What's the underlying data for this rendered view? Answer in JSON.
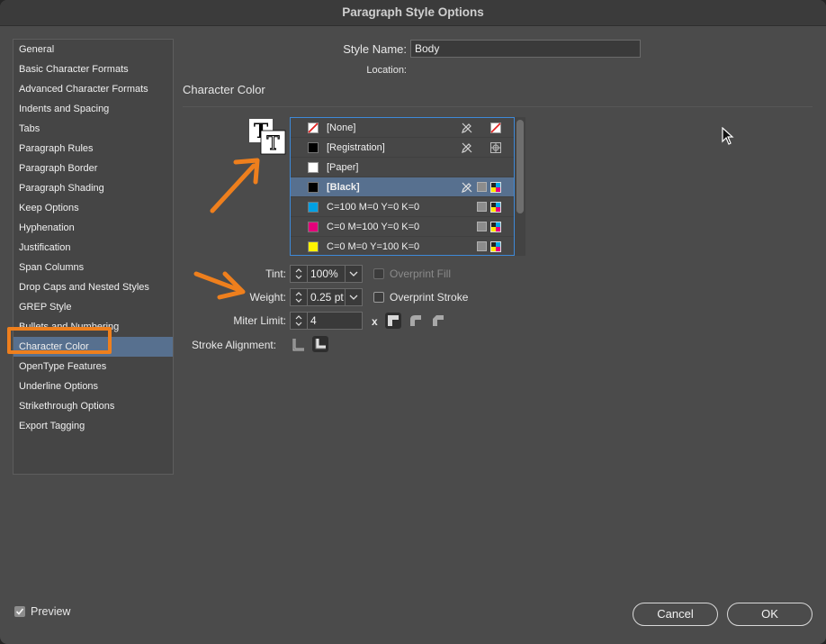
{
  "window": {
    "title": "Paragraph Style Options"
  },
  "sidebar": {
    "items": [
      {
        "label": "General"
      },
      {
        "label": "Basic Character Formats"
      },
      {
        "label": "Advanced Character Formats"
      },
      {
        "label": "Indents and Spacing"
      },
      {
        "label": "Tabs"
      },
      {
        "label": "Paragraph Rules"
      },
      {
        "label": "Paragraph Border"
      },
      {
        "label": "Paragraph Shading"
      },
      {
        "label": "Keep Options"
      },
      {
        "label": "Hyphenation"
      },
      {
        "label": "Justification"
      },
      {
        "label": "Span Columns"
      },
      {
        "label": "Drop Caps and Nested Styles"
      },
      {
        "label": "GREP Style"
      },
      {
        "label": "Bullets and Numbering"
      },
      {
        "label": "Character Color",
        "selected": true
      },
      {
        "label": "OpenType Features"
      },
      {
        "label": "Underline Options"
      },
      {
        "label": "Strikethrough Options"
      },
      {
        "label": "Export Tagging"
      }
    ]
  },
  "header": {
    "style_name_label": "Style Name:",
    "style_name_value": "Body",
    "location_label": "Location:"
  },
  "section": {
    "title": "Character Color"
  },
  "swatches": [
    {
      "name": "[None]",
      "color": "none",
      "icons": [
        "pencil-icon",
        "none-swatch-icon"
      ]
    },
    {
      "name": "[Registration]",
      "color": "#000000",
      "icons": [
        "pencil-icon",
        "registration-icon"
      ]
    },
    {
      "name": "[Paper]",
      "color": "#ffffff",
      "icons": []
    },
    {
      "name": "[Black]",
      "color": "#000000",
      "icons": [
        "pencil-icon",
        "gray-box-icon",
        "cmyk-icon"
      ],
      "selected": true
    },
    {
      "name": "C=100 M=0 Y=0 K=0",
      "color": "#00a0e4",
      "icons": [
        "gray-box-icon",
        "cmyk-icon"
      ]
    },
    {
      "name": "C=0 M=100 Y=0 K=0",
      "color": "#e4007b",
      "icons": [
        "gray-box-icon",
        "cmyk-icon"
      ]
    },
    {
      "name": "C=0 M=0 Y=100 K=0",
      "color": "#fff200",
      "icons": [
        "gray-box-icon",
        "cmyk-icon"
      ]
    }
  ],
  "stroke": {
    "tint_label": "Tint:",
    "tint_value": "100%",
    "weight_label": "Weight:",
    "weight_value": "0.25 pt",
    "miter_label": "Miter Limit:",
    "miter_value": "4",
    "miter_x": "x",
    "alignment_label": "Stroke Alignment:",
    "overprint_fill_label": "Overprint Fill",
    "overprint_fill_checked": false,
    "overprint_stroke_label": "Overprint Stroke",
    "overprint_stroke_checked": false
  },
  "footer": {
    "preview_label": "Preview",
    "preview_checked": true,
    "cancel_label": "Cancel",
    "ok_label": "OK"
  },
  "colors": {
    "accent": "#57708f",
    "callout": "#ee7f1d",
    "list_border": "#3e89d8"
  }
}
